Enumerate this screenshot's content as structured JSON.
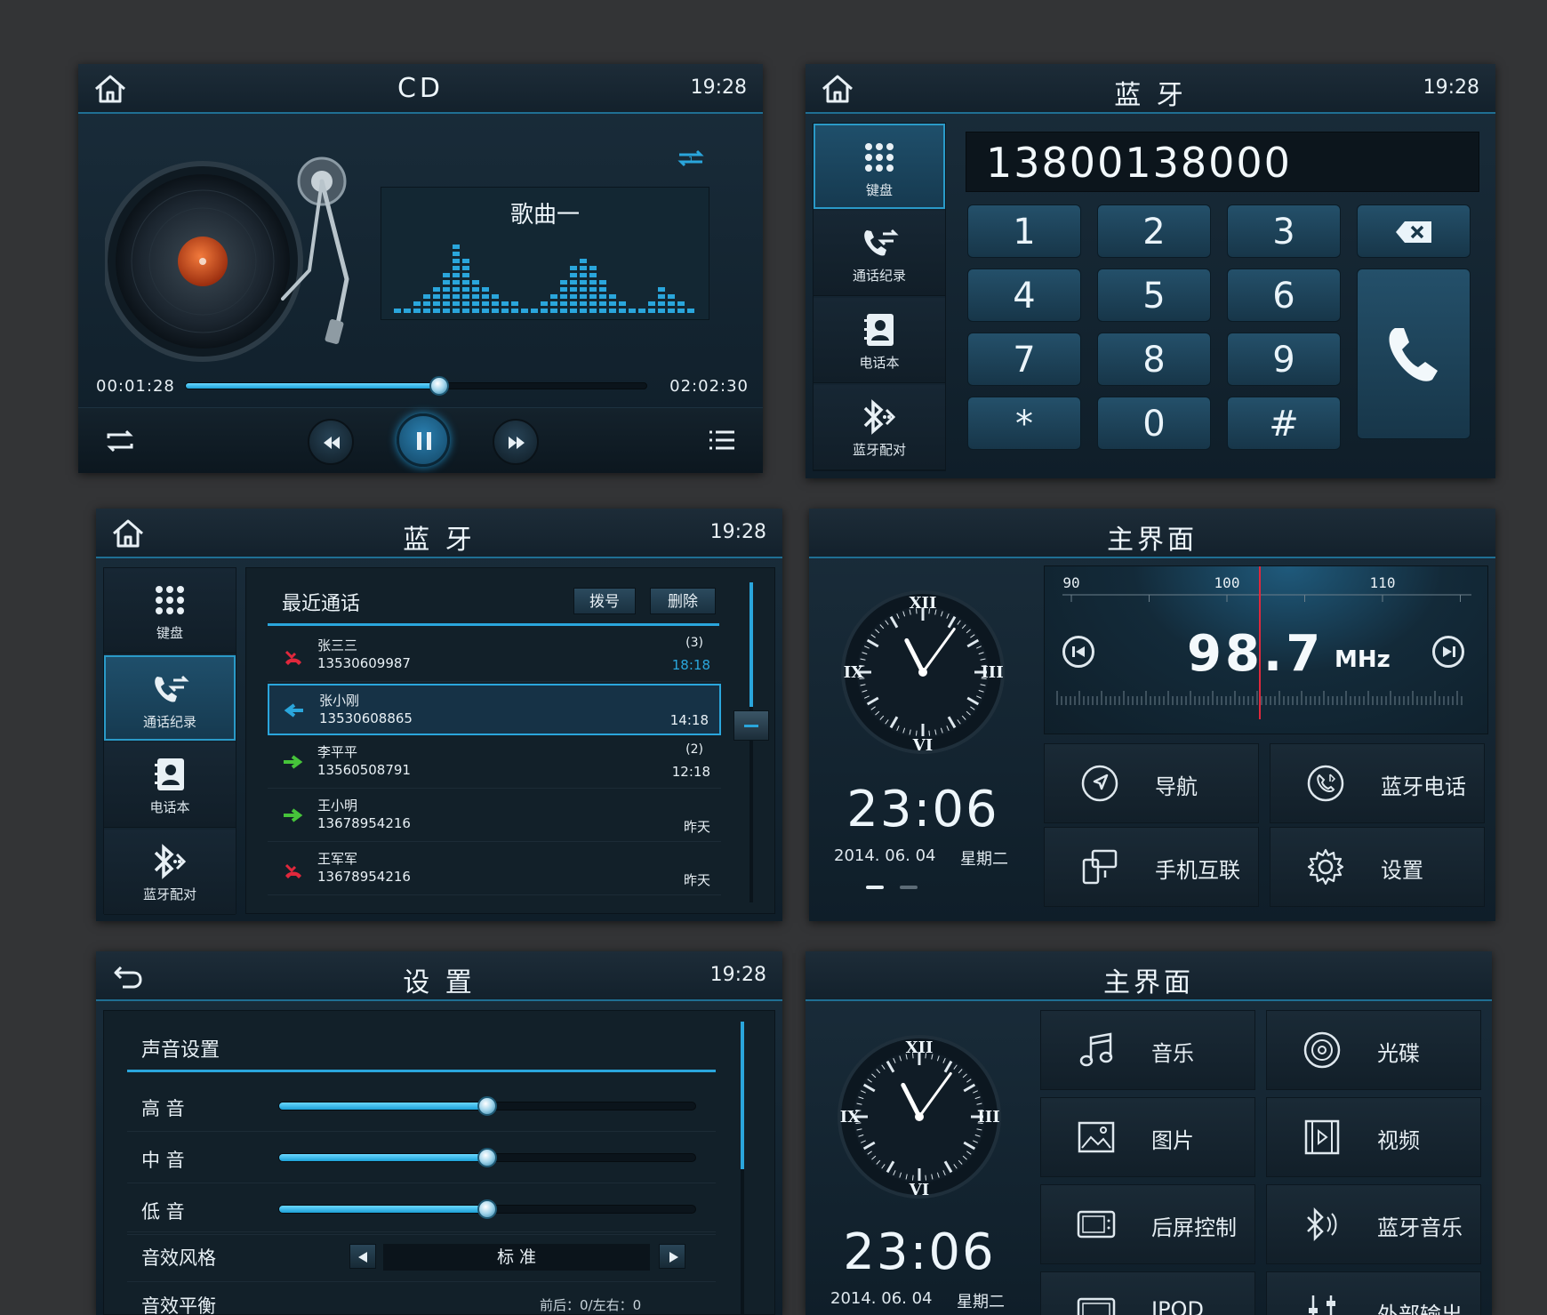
{
  "time": "19:28",
  "cd": {
    "title": "CD",
    "song": "歌曲一",
    "elapsed": "00:01:28",
    "total": "02:02:30",
    "progress": 0.55
  },
  "dialer": {
    "title": "蓝 牙",
    "number": "13800138000",
    "keys": [
      "1",
      "2",
      "3",
      "4",
      "5",
      "6",
      "7",
      "8",
      "9",
      "*",
      "0",
      "#"
    ]
  },
  "bt_nav": {
    "keyboard": "键盘",
    "call_log": "通话纪录",
    "phonebook": "电话本",
    "pairing": "蓝牙配对"
  },
  "calls": {
    "title": "蓝 牙",
    "section": "最近通话",
    "dial_btn": "拨号",
    "delete_btn": "删除",
    "rows": [
      {
        "name": "张三三",
        "number": "13530609987",
        "count": "(3)",
        "time": "18:18",
        "type": "missed"
      },
      {
        "name": "张小刚",
        "number": "13530608865",
        "count": "",
        "time": "14:18",
        "type": "incoming"
      },
      {
        "name": "李平平",
        "number": "13560508791",
        "count": "(2)",
        "time": "12:18",
        "type": "outgoing"
      },
      {
        "name": "王小明",
        "number": "13678954216",
        "count": "",
        "time": "昨天",
        "type": "outgoing"
      },
      {
        "name": "王军军",
        "number": "13678954216",
        "count": "",
        "time": "昨天",
        "type": "missed"
      }
    ]
  },
  "home1": {
    "title": "主界面",
    "clock_time": "23:06",
    "date": "2014. 06. 04",
    "weekday": "星期二",
    "radio": {
      "freq": "98.7",
      "unit": "MHz",
      "ticks": [
        "90",
        "100",
        "110"
      ]
    },
    "tiles": [
      "导航",
      "蓝牙电话",
      "手机互联",
      "设置"
    ]
  },
  "settings": {
    "title": "设 置",
    "section": "声音设置",
    "rows": [
      {
        "label": "高 音",
        "value": 0.5
      },
      {
        "label": "中 音",
        "value": 0.5
      },
      {
        "label": "低 音",
        "value": 0.5
      }
    ],
    "style_label": "音效风格",
    "style_value": "标 准",
    "balance_label": "音效平衡",
    "balance_value": "前后：0/左右：0"
  },
  "home2": {
    "title": "主界面",
    "clock_time": "23:06",
    "date": "2014. 06. 04",
    "weekday": "星期二",
    "tiles": [
      "音乐",
      "光碟",
      "图片",
      "视频",
      "后屏控制",
      "蓝牙音乐",
      "IPOD",
      "外部输出"
    ]
  },
  "clock_numerals": {
    "xii": "XII",
    "iii": "III",
    "vi": "VI",
    "ix": "IX"
  },
  "colors": {
    "accent": "#2aa6dc",
    "missed": "#e0283c",
    "outgoing": "#46c43a",
    "incoming": "#2aa6dc"
  }
}
